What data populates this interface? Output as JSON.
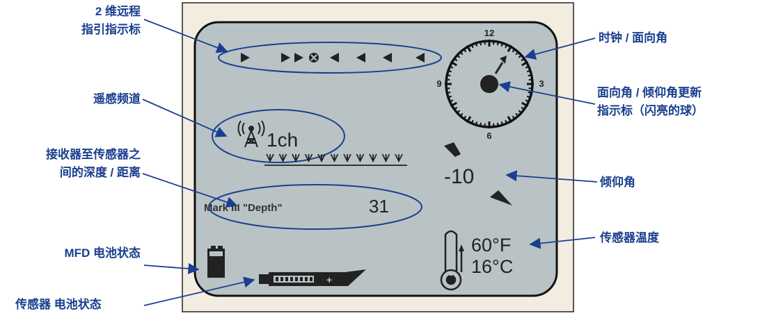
{
  "colors": {
    "callout_text": "#1a3f8f",
    "callout_line": "#1a3f8f",
    "outer_panel": "#f3ece0",
    "lcd_screen": "#b9c3c5",
    "lcd_ink": "#222222"
  },
  "callouts": {
    "guidance_line1": "2 维远程",
    "guidance_line2": "指引指示标",
    "telemetry_channel": "遥感频道",
    "depth_line1": "接收器至传感器之",
    "depth_line2": "间的深度 / 距离",
    "mfd_battery": "MFD 电池状态",
    "sensor_battery": "传感器 电池状态",
    "clock_roll": "时钟 / 面向角",
    "update_line1": "面向角 / 倾仰角更新",
    "update_line2": "指示标（闪亮的球）",
    "pitch": "倾仰角",
    "sensor_temp": "传感器温度"
  },
  "screen": {
    "channel_text": "1ch",
    "clock_12": "12",
    "clock_3": "3",
    "clock_6": "6",
    "clock_9": "9",
    "pitch_value": "-10",
    "depth_label": "Mark III \"Depth\"",
    "depth_value": "31",
    "temp_f": "60°F",
    "temp_c": "16°C"
  }
}
